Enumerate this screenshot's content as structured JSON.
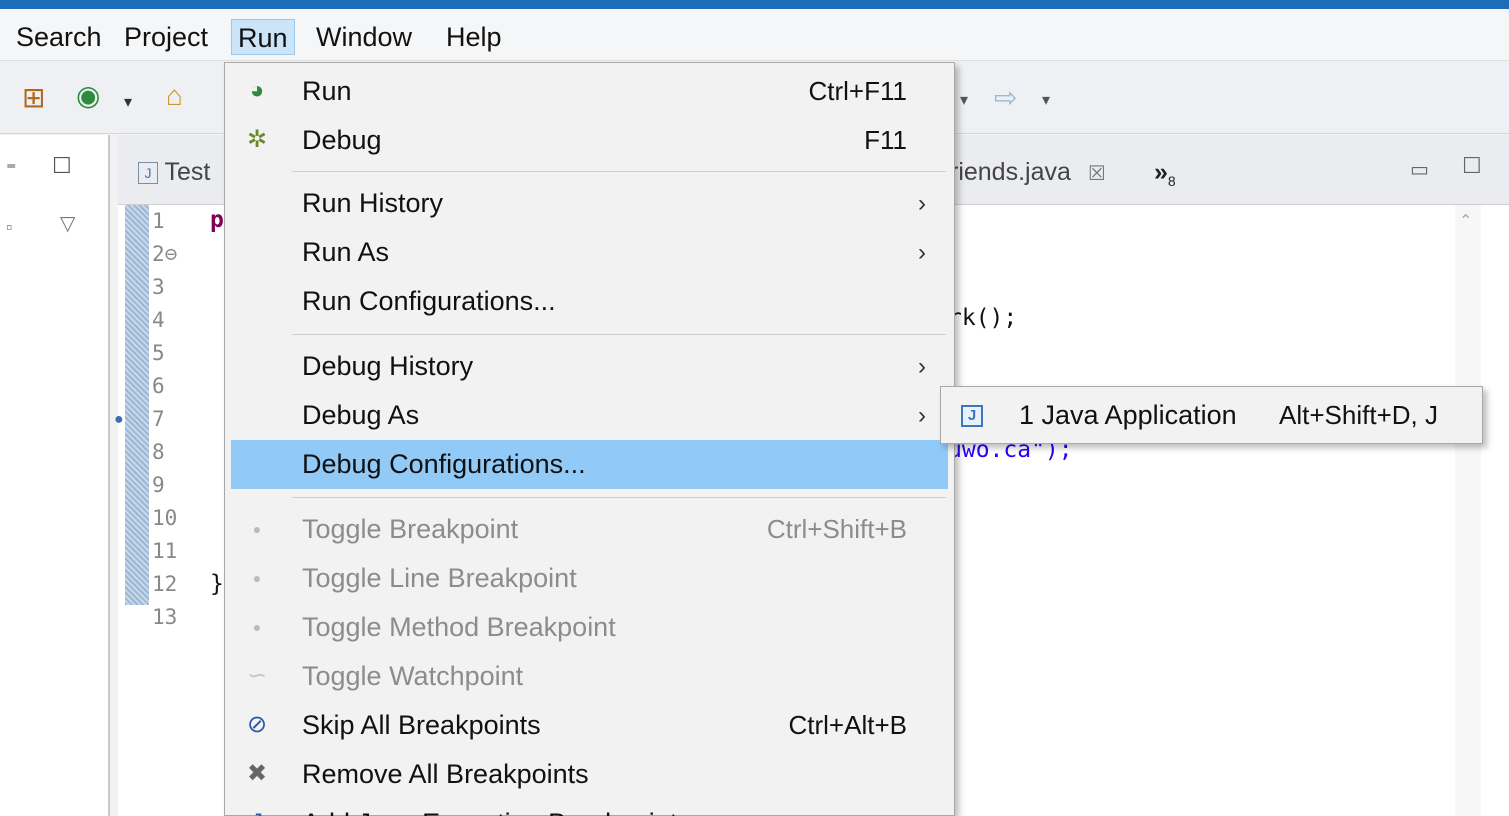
{
  "menubar": {
    "items": [
      "Search",
      "Project",
      "Run",
      "Window",
      "Help"
    ],
    "active": "Run"
  },
  "editor": {
    "tabs": {
      "left": "Test",
      "right": "riends.java",
      "close_glyph": "☒",
      "overflow": "»",
      "overflow_count": "8"
    },
    "line_numbers": [
      "1",
      "2⊖",
      "3",
      "4",
      "5",
      "6",
      "7",
      "8",
      "9",
      "10",
      "11",
      "12",
      "13"
    ],
    "code": {
      "line1": "p",
      "line4": "rk();",
      "line6": "",
      "line8": "uwo.ca\");",
      "line12": "}"
    }
  },
  "run_menu": {
    "items": [
      {
        "label": "Run",
        "accel": "Ctrl+F11",
        "icon": "run-icon"
      },
      {
        "label": "Debug",
        "accel": "F11",
        "icon": "debug-icon"
      },
      {
        "label": "Run History",
        "submenu": true
      },
      {
        "label": "Run As",
        "submenu": true
      },
      {
        "label": "Run Configurations..."
      },
      {
        "label": "Debug History",
        "submenu": true
      },
      {
        "label": "Debug As",
        "submenu": true
      },
      {
        "label": "Debug Configurations...",
        "highlighted": true
      },
      {
        "label": "Toggle Breakpoint",
        "accel": "Ctrl+Shift+B",
        "disabled": true,
        "icon": "breakpoint-dot-icon"
      },
      {
        "label": "Toggle Line Breakpoint",
        "disabled": true,
        "icon": "breakpoint-dot-icon"
      },
      {
        "label": "Toggle Method Breakpoint",
        "disabled": true,
        "icon": "breakpoint-dot-icon"
      },
      {
        "label": "Toggle Watchpoint",
        "disabled": true,
        "icon": "watchpoint-icon"
      },
      {
        "label": "Skip All Breakpoints",
        "accel": "Ctrl+Alt+B",
        "icon": "skip-breakpoints-icon"
      },
      {
        "label": "Remove All Breakpoints",
        "icon": "remove-breakpoints-icon"
      },
      {
        "label": "Add Java Exception Breakpoint...",
        "icon": "exception-breakpoint-icon"
      }
    ]
  },
  "debug_as_submenu": {
    "label": "1 Java Application",
    "accel": "Alt+Shift+D, J",
    "icon": "java-app-icon",
    "icon_glyph": "J"
  },
  "colors": {
    "highlight": "#91c9f7",
    "topbar": "#1e6bb8",
    "disabled_text": "#8c8c8c"
  }
}
